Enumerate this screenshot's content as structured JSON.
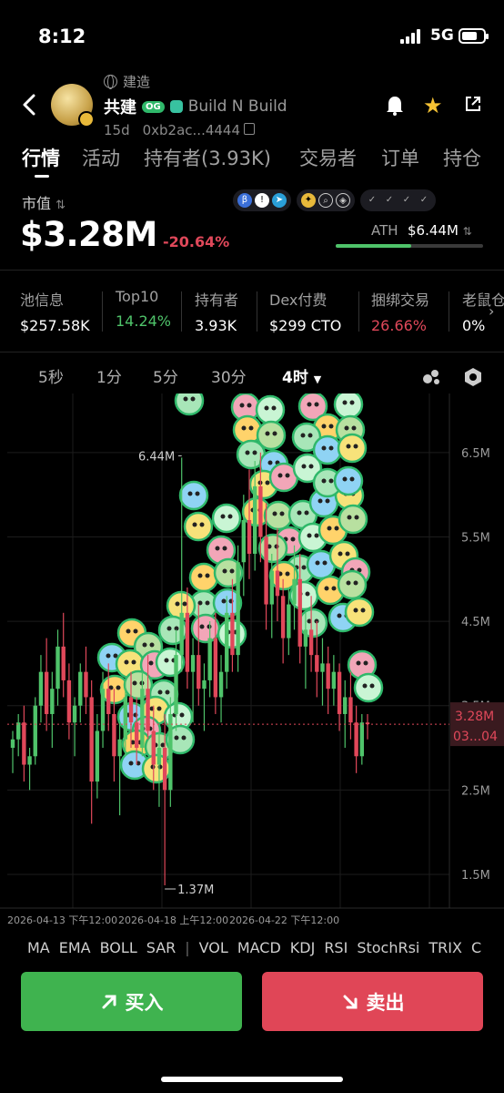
{
  "status_bar": {
    "time": "8:12",
    "network": "5G"
  },
  "token": {
    "build_tag": "建造",
    "name": "共建",
    "og_badge": "OG",
    "full_name": "Build N Build",
    "age": "15d",
    "address": "0xb2ac...4444"
  },
  "tabs": [
    "行情",
    "活动",
    "持有者(3.93K)",
    "交易者",
    "订单",
    "持仓"
  ],
  "market": {
    "label": "市值",
    "value": "$3.28M",
    "change": "-20.64%",
    "ath_label": "ATH",
    "ath_value": "$6.44M",
    "ath_progress": 0.51
  },
  "stats": [
    {
      "label": "池信息",
      "value": "$257.58K",
      "color": "#ffffff"
    },
    {
      "label": "Top10",
      "value": "14.24%",
      "color": "#4fc36a"
    },
    {
      "label": "持有者",
      "value": "3.93K",
      "color": "#ffffff"
    },
    {
      "label": "Dex付费",
      "value": "$299 CTO",
      "color": "#ffffff"
    },
    {
      "label": "捆绑交易",
      "value": "26.66%",
      "color": "#e0485a"
    },
    {
      "label": "老鼠仓",
      "value": "0%",
      "color": "#ffffff"
    }
  ],
  "intervals": [
    "5秒",
    "1分",
    "5分",
    "30分",
    "4时"
  ],
  "active_interval": "4时",
  "chart_data": {
    "type": "candlestick",
    "y_ticks": [
      "6.5M",
      "5.5M",
      "4.5M",
      "3.5M",
      "2.5M",
      "1.5M"
    ],
    "ylim": [
      1.1,
      7.2
    ],
    "x_ticks": [
      "2026-04-13 下午12:00",
      "2026-04-18 上午12:00",
      "2026-04-22 下午12:00"
    ],
    "high_marker": "6.44M",
    "low_marker": "1.37M",
    "current_price": "3.28M",
    "current_countdown": "03...04",
    "candles": [
      [
        3.0,
        3.2,
        2.7,
        3.1
      ],
      [
        3.1,
        3.4,
        2.9,
        3.3
      ],
      [
        3.3,
        3.5,
        2.6,
        2.8
      ],
      [
        2.8,
        3.0,
        2.5,
        2.9
      ],
      [
        2.9,
        3.6,
        2.8,
        3.5
      ],
      [
        3.5,
        4.1,
        3.3,
        3.9
      ],
      [
        3.9,
        4.3,
        3.2,
        3.4
      ],
      [
        3.4,
        3.9,
        3.0,
        3.7
      ],
      [
        3.7,
        4.4,
        3.5,
        4.2
      ],
      [
        4.2,
        4.6,
        3.6,
        3.8
      ],
      [
        3.8,
        4.0,
        3.1,
        3.3
      ],
      [
        3.3,
        3.6,
        2.9,
        3.5
      ],
      [
        3.5,
        4.0,
        3.3,
        3.9
      ],
      [
        3.9,
        4.2,
        3.4,
        3.6
      ],
      [
        3.6,
        3.8,
        2.1,
        2.6
      ],
      [
        2.6,
        3.4,
        2.4,
        3.2
      ],
      [
        3.2,
        3.9,
        3.0,
        3.7
      ],
      [
        3.7,
        4.0,
        3.2,
        3.4
      ],
      [
        3.4,
        3.7,
        2.6,
        2.9
      ],
      [
        2.9,
        3.3,
        2.2,
        3.1
      ],
      [
        3.1,
        3.8,
        2.9,
        3.6
      ],
      [
        3.6,
        3.9,
        3.0,
        3.3
      ],
      [
        3.3,
        3.6,
        2.8,
        3.0
      ],
      [
        3.0,
        3.9,
        2.9,
        3.7
      ],
      [
        3.7,
        4.1,
        3.1,
        3.2
      ],
      [
        3.2,
        3.5,
        2.5,
        2.8
      ],
      [
        2.8,
        3.2,
        2.3,
        3.0
      ],
      [
        3.0,
        3.4,
        1.37,
        2.5
      ],
      [
        2.5,
        3.6,
        2.3,
        3.4
      ],
      [
        3.4,
        4.4,
        3.2,
        4.1
      ],
      [
        4.1,
        6.44,
        3.9,
        4.6
      ],
      [
        4.6,
        4.9,
        3.7,
        3.9
      ],
      [
        3.9,
        4.3,
        3.3,
        4.1
      ],
      [
        4.1,
        4.7,
        3.5,
        3.7
      ],
      [
        3.7,
        4.0,
        3.2,
        3.8
      ],
      [
        3.8,
        4.5,
        3.6,
        4.3
      ],
      [
        4.3,
        4.6,
        3.4,
        3.6
      ],
      [
        3.6,
        4.1,
        3.3,
        3.9
      ],
      [
        3.9,
        4.8,
        3.7,
        4.6
      ],
      [
        4.6,
        5.0,
        3.9,
        4.1
      ],
      [
        4.1,
        5.4,
        3.9,
        5.2
      ],
      [
        5.2,
        6.0,
        4.8,
        5.7
      ],
      [
        5.7,
        6.3,
        5.0,
        5.3
      ],
      [
        5.3,
        6.4,
        5.1,
        6.1
      ],
      [
        6.1,
        6.5,
        5.2,
        5.5
      ],
      [
        5.5,
        5.9,
        4.4,
        4.7
      ],
      [
        4.7,
        5.3,
        4.3,
        5.1
      ],
      [
        5.1,
        5.6,
        4.5,
        4.8
      ],
      [
        4.8,
        5.0,
        4.0,
        4.3
      ],
      [
        4.3,
        4.9,
        4.1,
        4.7
      ],
      [
        4.7,
        5.4,
        4.4,
        5.0
      ],
      [
        5.0,
        5.3,
        4.0,
        4.2
      ],
      [
        4.2,
        4.6,
        3.7,
        4.4
      ],
      [
        4.4,
        4.8,
        3.9,
        4.1
      ],
      [
        4.1,
        4.5,
        3.6,
        3.9
      ],
      [
        3.9,
        4.3,
        3.5,
        4.0
      ],
      [
        4.0,
        4.2,
        3.4,
        3.7
      ],
      [
        3.7,
        4.1,
        3.5,
        3.9
      ],
      [
        3.9,
        4.0,
        3.2,
        3.4
      ],
      [
        3.4,
        3.8,
        3.0,
        3.6
      ],
      [
        3.6,
        3.9,
        3.1,
        3.3
      ],
      [
        3.3,
        3.5,
        2.7,
        2.9
      ],
      [
        2.9,
        3.4,
        2.8,
        3.3
      ],
      [
        3.3,
        3.4,
        3.1,
        3.28
      ]
    ]
  },
  "indicators": [
    "MA",
    "EMA",
    "BOLL",
    "SAR",
    "|",
    "VOL",
    "MACD",
    "KDJ",
    "RSI",
    "StochRsi",
    "TRIX",
    "C"
  ],
  "actions": {
    "buy": "买入",
    "sell": "卖出"
  },
  "colors": {
    "up": "#4fc36a",
    "down": "#e0485a",
    "buy": "#3fb34f",
    "sell": "#e04657"
  }
}
